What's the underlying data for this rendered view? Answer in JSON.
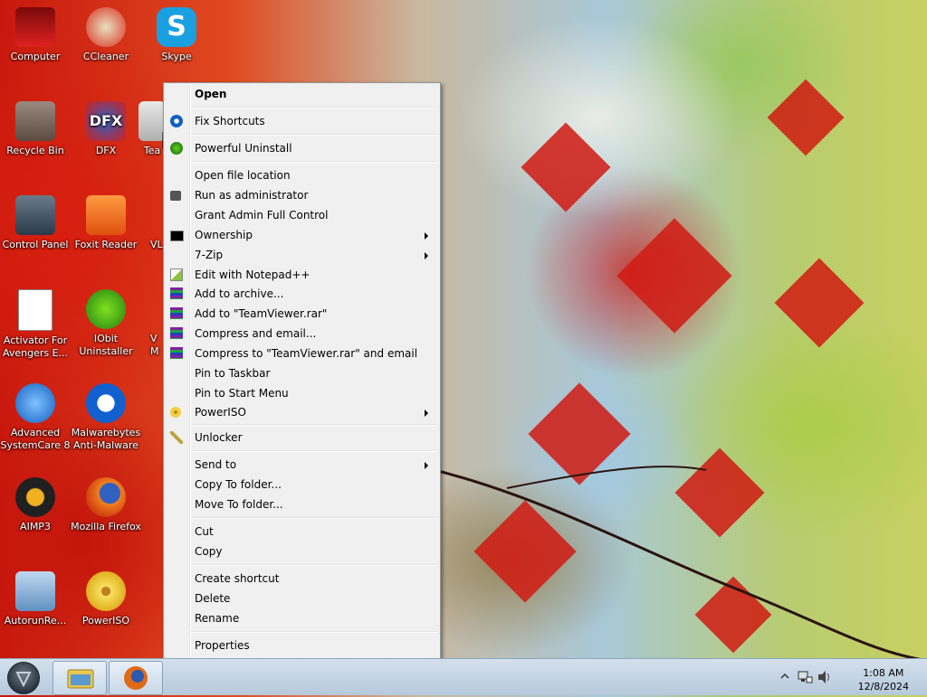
{
  "desktop": {
    "icons": [
      {
        "label": "Computer",
        "icon": "computer-icon"
      },
      {
        "label": "CCleaner",
        "icon": "ccleaner-icon"
      },
      {
        "label": "Skype",
        "icon": "skype-icon"
      },
      {
        "label": "Recycle Bin",
        "icon": "recycle-bin-icon"
      },
      {
        "label": "DFX",
        "icon": "dfx-icon"
      },
      {
        "label": "Tea",
        "icon": "teamviewer-icon"
      },
      {
        "label": "Control Panel",
        "icon": "control-panel-icon"
      },
      {
        "label": "Foxit Reader",
        "icon": "foxit-reader-icon"
      },
      {
        "label": "VL",
        "icon": "vlc-icon"
      },
      {
        "label": "Activator For Avengers E...",
        "icon": "activator-icon"
      },
      {
        "label": "IObit Uninstaller",
        "icon": "iobit-uninstaller-icon"
      },
      {
        "label": "V M",
        "icon": "partial-icon"
      },
      {
        "label": "Advanced SystemCare 8",
        "icon": "advanced-systemcare-icon"
      },
      {
        "label": "Malwarebytes Anti-Malware",
        "icon": "malwarebytes-icon"
      },
      {
        "label": "AIMP3",
        "icon": "aimp3-icon"
      },
      {
        "label": "Mozilla Firefox",
        "icon": "firefox-icon"
      },
      {
        "label": "AutorunRe...",
        "icon": "autorun-icon"
      },
      {
        "label": "PowerISO",
        "icon": "poweriso-icon"
      }
    ]
  },
  "context_menu": {
    "items": {
      "open": "Open",
      "fix_shortcuts": "Fix Shortcuts",
      "powerful_uninstall": "Powerful Uninstall",
      "open_file_location": "Open file location",
      "run_as_admin": "Run as administrator",
      "grant_admin": "Grant Admin Full Control",
      "ownership": "Ownership",
      "seven_zip": "7-Zip",
      "edit_notepad": "Edit with Notepad++",
      "add_archive": "Add to archive...",
      "add_rar": "Add to \"TeamViewer.rar\"",
      "compress_email": "Compress and email...",
      "compress_rar_email": "Compress to \"TeamViewer.rar\" and email",
      "pin_taskbar": "Pin to Taskbar",
      "pin_start": "Pin to Start Menu",
      "poweriso": "PowerISO",
      "unlocker": "Unlocker",
      "send_to": "Send to",
      "copy_to_folder": "Copy To folder...",
      "move_to_folder": "Move To folder...",
      "cut": "Cut",
      "copy": "Copy",
      "create_shortcut": "Create shortcut",
      "delete": "Delete",
      "rename": "Rename",
      "properties": "Properties"
    }
  },
  "taskbar": {
    "clock_time": "1:08 AM",
    "clock_date": "12/8/2024",
    "pinned": [
      "file-explorer-icon",
      "firefox-icon"
    ]
  },
  "colors": {
    "menu_bg": "#f0f0f0",
    "menu_border": "#979797",
    "taskbar_top": "#d4e0ec"
  }
}
